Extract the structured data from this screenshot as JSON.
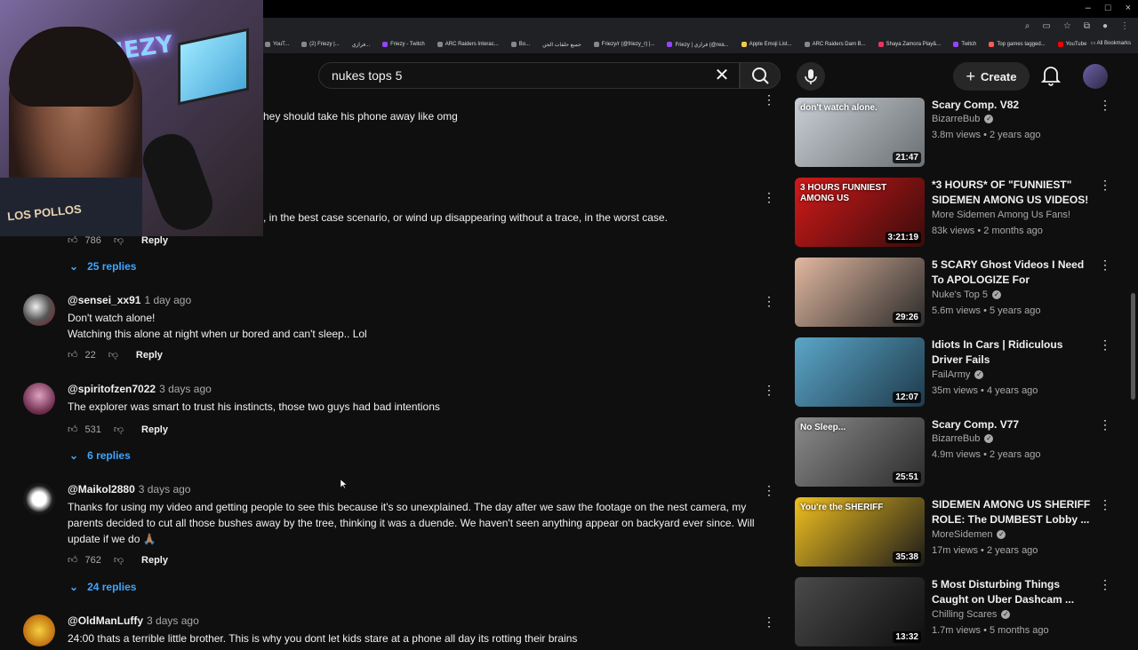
{
  "browser": {
    "window_controls": [
      "–",
      "□",
      "×"
    ],
    "toolbar_icons": [
      "zoom-icon",
      "cast-icon",
      "star-icon",
      "extensions-icon",
      "profile-icon",
      "menu-icon"
    ],
    "bookmarks": [
      "YouT...",
      "(2) Friezy |...",
      "فرازي...",
      "Friezy - Twitch",
      "ARC Raiders Interac...",
      "Bo...",
      "جميع حلقات الجن",
      "Friezy/r (@friezy_r) |...",
      "Friezy | فرازي (@rea...",
      "Apple Emoji List...",
      "ARC Raiders Dam B...",
      "Shaya Zamora Play&...",
      "Twitch",
      "Top games tagged...",
      "YouTube"
    ],
    "all_bookmarks": "All Bookmarks"
  },
  "webcam": {
    "neon_sign": "FRIEZY",
    "shirt_text": "LOS POLLOS"
  },
  "header": {
    "search_value": "nukes tops 5",
    "create_label": "Create"
  },
  "comments": {
    "fragment_1": "hey should take his phone away like omg",
    "fragment_2": ", in the best case scenario, or wind up disappearing without a trace, in the worst case.",
    "fragment_2_likes": "786",
    "fragment_2_replies": "25 replies",
    "reply_label": "Reply",
    "items": [
      {
        "user": "@sensei_xx91",
        "time": "1 day ago",
        "line1": "Don't watch alone!",
        "line2": "Watching this alone at night when ur bored and can't sleep.. Lol",
        "likes": "22"
      },
      {
        "user": "@spiritofzen7022",
        "time": "3 days ago",
        "line1": "The explorer was smart to trust his instincts, those two guys had bad intentions",
        "likes": "531",
        "replies": "6 replies"
      },
      {
        "user": "@Maikol2880",
        "time": "3 days ago",
        "line1": "Thanks for using my video and getting people to see this because it's so unexplained. The day after we saw the footage on the nest camera, my parents decided to cut all those bushes away by the tree, thinking it was a duende. We haven't seen anything appear on backyard ever since. Will update if we do 🙏🏽",
        "likes": "762",
        "replies": "24 replies"
      },
      {
        "user": "@OldManLuffy",
        "time": "3 days ago",
        "line1": "24:00 thats a terrible little brother. This is why you dont let kids stare at a phone all day its rotting their brains"
      }
    ]
  },
  "recommendations": [
    {
      "title": "Scary Comp. V82",
      "channel": "BizarreBub",
      "views": "3.8m views",
      "age": "2 years ago",
      "duration": "21:47",
      "thumb_text": "don't watch alone.",
      "colors": [
        "#c9cfd4",
        "#6a6f73"
      ]
    },
    {
      "title": "*3 HOURS* OF \"FUNNIEST\" SIDEMEN AMONG US VIDEOS!",
      "channel": "More Sidemen Among Us Fans!",
      "views": "83k views",
      "age": "2 months ago",
      "duration": "3:21:19",
      "thumb_text": "3 HOURS FUNNIEST AMONG US",
      "colors": [
        "#d11a1a",
        "#3a0b0b"
      ]
    },
    {
      "title": "5 SCARY Ghost Videos I Need To APOLOGIZE For",
      "channel": "Nuke's Top 5",
      "views": "5.6m views",
      "age": "5 years ago",
      "duration": "29:26",
      "thumb_text": "",
      "colors": [
        "#e2b8a0",
        "#2a2a2a"
      ]
    },
    {
      "title": "Idiots In Cars | Ridiculous Driver Fails",
      "channel": "FailArmy",
      "views": "35m views",
      "age": "4 years ago",
      "duration": "12:07",
      "thumb_text": "",
      "colors": [
        "#5ba6c9",
        "#1e3a4a"
      ]
    },
    {
      "title": "Scary Comp. V77",
      "channel": "BizarreBub",
      "views": "4.9m views",
      "age": "2 years ago",
      "duration": "25:51",
      "thumb_text": "No Sleep...",
      "colors": [
        "#8b8b8b",
        "#2b2b2b"
      ]
    },
    {
      "title": "SIDEMEN AMONG US SHERIFF ROLE: The DUMBEST Lobby ...",
      "channel": "MoreSidemen",
      "views": "17m views",
      "age": "2 years ago",
      "duration": "35:38",
      "thumb_text": "You're the SHERIFF",
      "colors": [
        "#f0c020",
        "#1a1a1a"
      ]
    },
    {
      "title": "5 Most Disturbing Things Caught on Uber Dashcam ...",
      "channel": "Chilling Scares",
      "views": "1.7m views",
      "age": "5 months ago",
      "duration": "13:32",
      "thumb_text": "",
      "colors": [
        "#4a4a4a",
        "#0e0e0e"
      ]
    }
  ]
}
